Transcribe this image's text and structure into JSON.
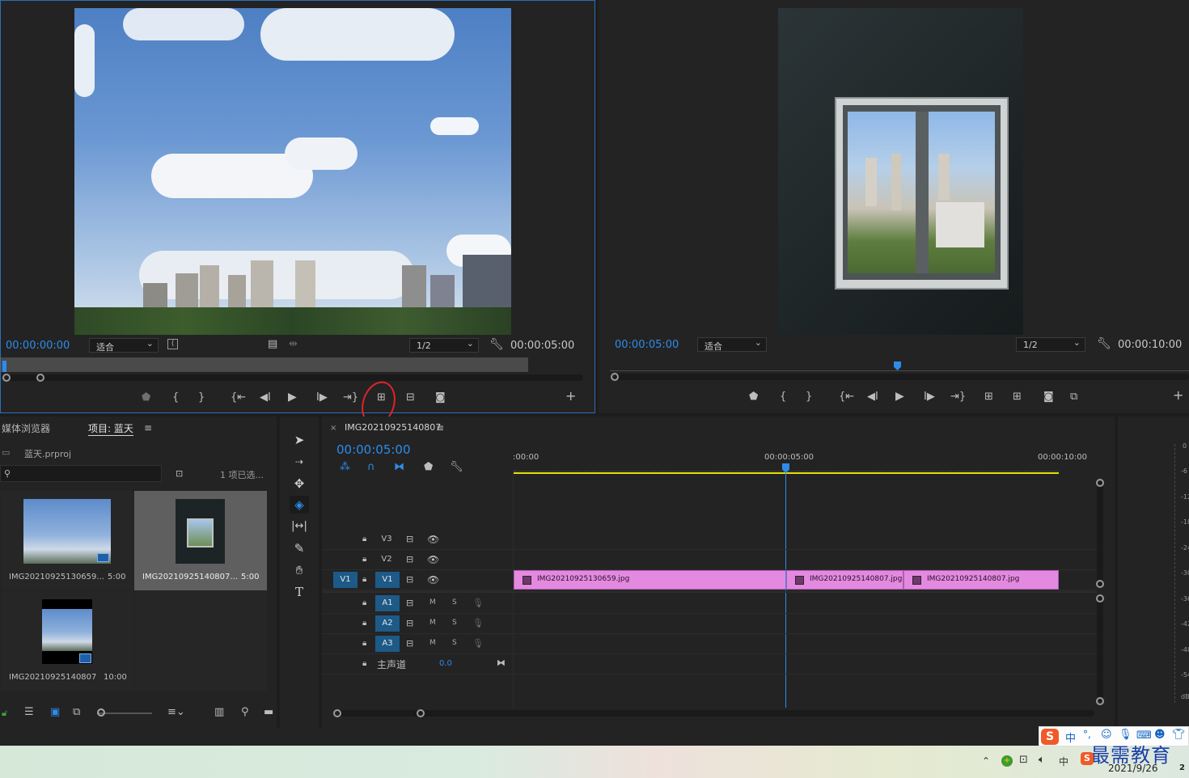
{
  "source_monitor": {
    "timecode_in": "00:00:00:00",
    "zoom": "适合",
    "resolution": "1/2",
    "timecode_out": "00:00:05:00"
  },
  "program_monitor": {
    "timecode_in": "00:00:05:00",
    "zoom": "适合",
    "resolution": "1/2",
    "timecode_out": "00:00:10:00"
  },
  "project_panel": {
    "tab_media_browser": "媒体浏览器",
    "tab_project": "项目: 蓝天",
    "project_file": "蓝天.prproj",
    "search_placeholder": "",
    "selection_status": "1 项已选...",
    "items": [
      {
        "name": "IMG20210925130659...",
        "duration": "5:00"
      },
      {
        "name": "IMG20210925140807...",
        "duration": "5:00"
      },
      {
        "name": "IMG20210925140807",
        "duration": "10:00"
      }
    ]
  },
  "timeline": {
    "sequence_name": "IMG20210925140807",
    "timecode": "00:00:05:00",
    "ruler": [
      ":00:00",
      "00:00:05:00",
      "00:00:10:00"
    ],
    "video_tracks": [
      "V3",
      "V2",
      "V1"
    ],
    "source_patch": "V1",
    "audio_tracks": [
      "A1",
      "A2",
      "A3"
    ],
    "mute_label": "M",
    "solo_label": "S",
    "master_label": "主声道",
    "master_value": "0.0",
    "clips": [
      "IMG20210925130659.jpg",
      "IMG20210925140807.jpg",
      "IMG20210925140807.jpg"
    ]
  },
  "audio_meter": {
    "labels": [
      "0",
      "-6",
      "-12",
      "-18",
      "-24",
      "-30",
      "-36",
      "-42",
      "-48",
      "-54",
      "dB"
    ]
  },
  "taskbar": {
    "date": "2021/9/26",
    "ime_label": "中",
    "watermark": "最需教育",
    "notification_count": "2"
  },
  "colors": {
    "accent_blue": "#2d8ceb",
    "clip_pink": "#e38ae0",
    "work_area_yellow": "#e3e300"
  }
}
